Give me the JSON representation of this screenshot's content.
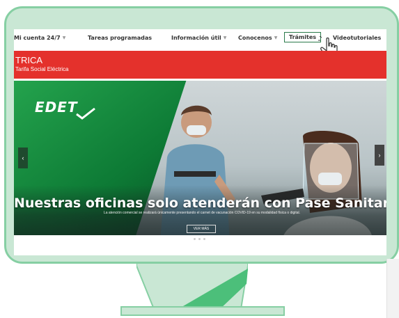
{
  "nav": {
    "items": [
      {
        "label": "Mi cuenta 24/7",
        "dropdown": true
      },
      {
        "label": "Tareas programadas",
        "dropdown": false
      },
      {
        "label": "Información útil",
        "dropdown": true
      },
      {
        "label": "Conocenos",
        "dropdown": true
      },
      {
        "label": "Trámites",
        "dropdown": false
      },
      {
        "label": "Videotutoriales",
        "dropdown": false
      }
    ]
  },
  "banner": {
    "title": "TRICA",
    "subtitle": "Tarifa Social Eléctrica"
  },
  "hero": {
    "logo": "EDET",
    "headline": "Nuestras oficinas solo atenderán con Pase Sanitario",
    "description": "La atención comercial se realizará únicamente presentando el carnet de vacunación COVID-19 en su modalidad física o digital.",
    "button_label": "VER MÁS",
    "prev_label": "‹",
    "next_label": "›"
  },
  "colors": {
    "accent_red": "#e4312c",
    "brand_green": "#1d9a45",
    "monitor_green": "#86cfa3"
  }
}
